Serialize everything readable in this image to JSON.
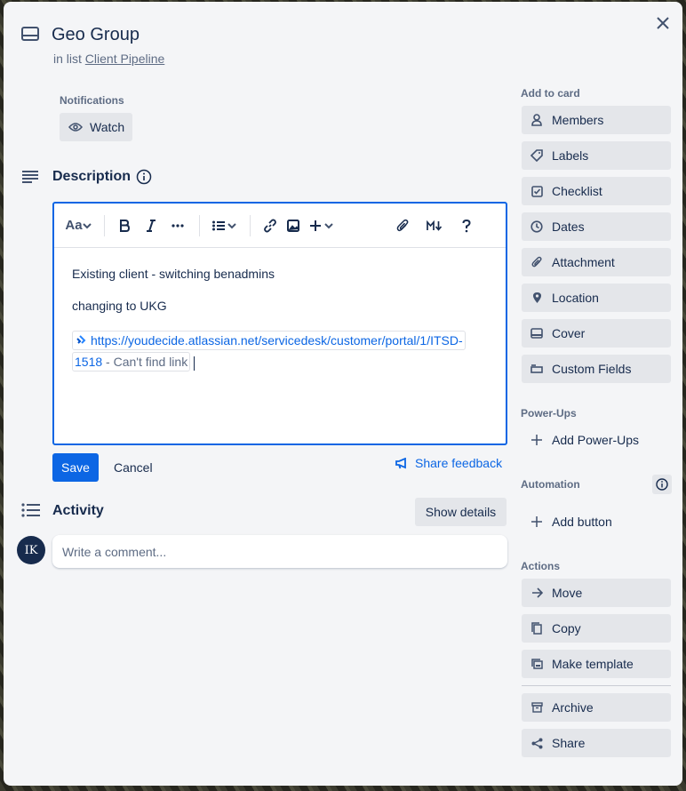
{
  "card": {
    "title": "Geo Group",
    "in_list_prefix": "in list",
    "list_name": "Client Pipeline"
  },
  "notifications": {
    "label": "Notifications",
    "watch_label": "Watch"
  },
  "description": {
    "title": "Description",
    "toolbar": {
      "text_style": "Aa"
    },
    "content": {
      "line1": "Existing client - switching benadmins",
      "line2": "changing to UKG",
      "link_url": "https://youdecide.atlassian.net/servicedesk/customer/portal/1/ITSD-1518",
      "link_title": " - Can't find link"
    },
    "save_label": "Save",
    "cancel_label": "Cancel",
    "feedback_label": "Share feedback"
  },
  "activity": {
    "title": "Activity",
    "show_details_label": "Show details",
    "avatar_initials": "IK",
    "comment_placeholder": "Write a comment..."
  },
  "sidebar": {
    "add_to_card_label": "Add to card",
    "add_items": [
      {
        "label": "Members",
        "icon": "person-icon"
      },
      {
        "label": "Labels",
        "icon": "tag-icon"
      },
      {
        "label": "Checklist",
        "icon": "checkbox-icon"
      },
      {
        "label": "Dates",
        "icon": "clock-icon"
      },
      {
        "label": "Attachment",
        "icon": "paperclip-icon"
      },
      {
        "label": "Location",
        "icon": "pin-icon"
      },
      {
        "label": "Cover",
        "icon": "card-cover-icon"
      },
      {
        "label": "Custom Fields",
        "icon": "custom-fields-icon"
      }
    ],
    "power_ups_label": "Power-Ups",
    "add_power_ups_label": "Add Power-Ups",
    "automation_label": "Automation",
    "add_button_label": "Add button",
    "actions_label": "Actions",
    "actions": [
      {
        "label": "Move",
        "icon": "arrow-right-icon"
      },
      {
        "label": "Copy",
        "icon": "copy-icon"
      },
      {
        "label": "Make template",
        "icon": "template-icon"
      },
      {
        "label": "Archive",
        "icon": "archive-icon"
      },
      {
        "label": "Share",
        "icon": "share-icon"
      }
    ]
  },
  "colors": {
    "primary": "#0c66e4",
    "modal_bg": "#f4f5f7",
    "button_bg": "#e4e6ea",
    "text": "#172b4d"
  }
}
